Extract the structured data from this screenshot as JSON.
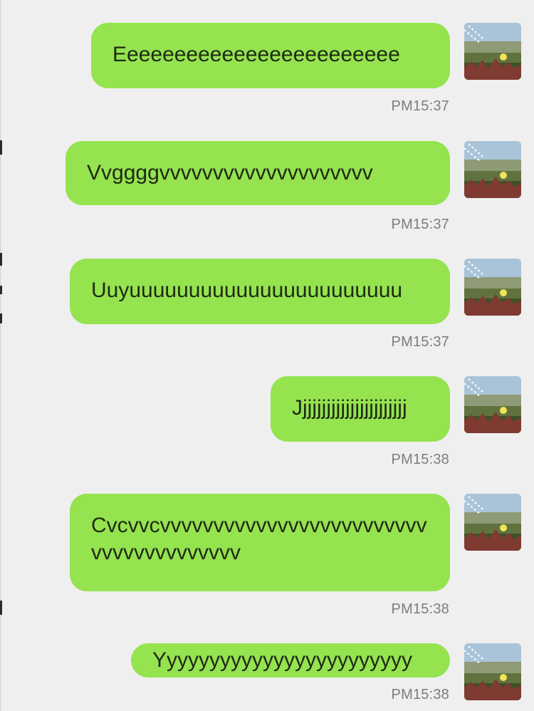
{
  "messages": [
    {
      "text": "Eeeeeeeeeeeeeeeeeeeeeeee",
      "time": "PM15:37"
    },
    {
      "text": "Vvggggvvvvvvvvvvvvvvvvvvvv",
      "time": "PM15:37"
    },
    {
      "text": "Uuyuuuuuuuuuuuuuuuuuuuuuuu",
      "time": "PM15:37"
    },
    {
      "text": "Jjjjjjjjjjjjjjjjjjjjjjj",
      "time": "PM15:38"
    },
    {
      "text": "Cvcvvcvvvvvvvvvvvvvvvvvvvvvvvvvvvvvvvvvvvvvvv",
      "time": "PM15:38"
    },
    {
      "text": "Yyyyyyyyyyyyyyyyyyyyyyyy",
      "time": "PM15:38"
    }
  ],
  "colors": {
    "background": "#efefef",
    "bubble": "#95e34f",
    "text": "#1f2a15",
    "timestamp": "#7d7d7d"
  },
  "icons": {
    "avatar": "landscape-avatar"
  }
}
